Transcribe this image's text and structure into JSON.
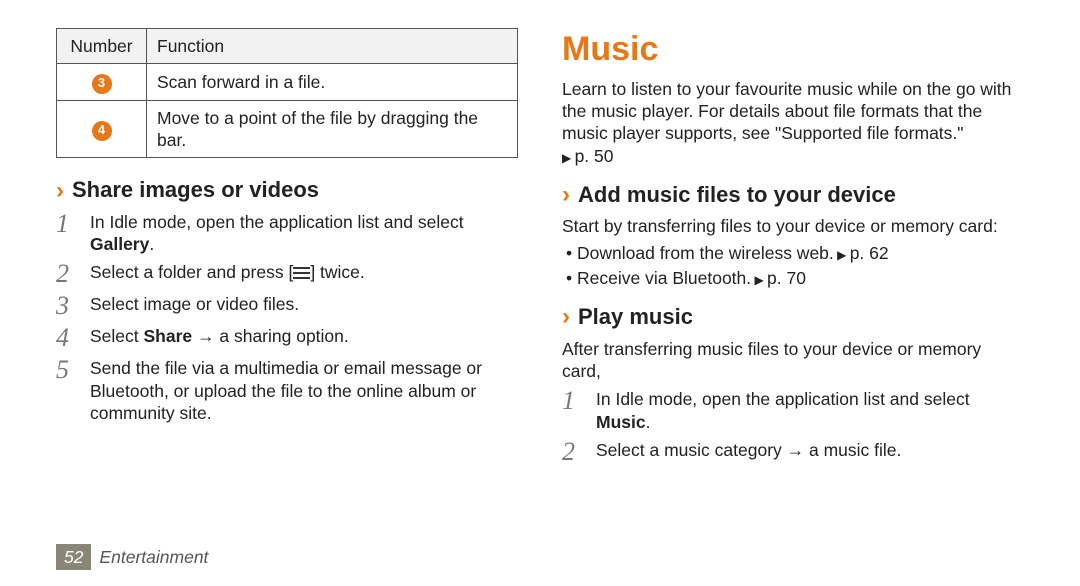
{
  "table": {
    "header_number": "Number",
    "header_function": "Function",
    "rows": [
      {
        "num": "3",
        "func": "Scan forward in a file."
      },
      {
        "num": "4",
        "func": "Move to a point of the file by dragging the bar."
      }
    ]
  },
  "left": {
    "subhead": "Share images or videos",
    "steps": [
      {
        "n": "1",
        "pre": "In Idle mode, open the application list and select ",
        "bold": "Gallery",
        "post": "."
      },
      {
        "n": "2",
        "pre": "Select a folder and press [",
        "icon": true,
        "post": "] twice."
      },
      {
        "n": "3",
        "pre": "Select image or video files.",
        "bold": "",
        "post": ""
      },
      {
        "n": "4",
        "pre": "Select ",
        "bold": "Share",
        "post": " → a sharing option."
      },
      {
        "n": "5",
        "pre": "Send the file via a multimedia or email message or Bluetooth, or upload the file to the online album or community site.",
        "bold": "",
        "post": ""
      }
    ]
  },
  "right": {
    "title": "Music",
    "intro": "Learn to listen to your favourite music while on the go with the music player. For details about file formats that the music player supports, see \"Supported file formats.\"",
    "intro_ref": "p. 50",
    "add_head": "Add music files to your device",
    "add_intro": "Start by transferring files to your device or memory card:",
    "add_bullets": [
      {
        "text": "Download from the wireless web.",
        "ref": "p. 62"
      },
      {
        "text": "Receive via Bluetooth.",
        "ref": "p. 70"
      }
    ],
    "play_head": "Play music",
    "play_intro": "After transferring music files to your device or memory card,",
    "play_steps": [
      {
        "n": "1",
        "pre": "In Idle mode, open the application list and select ",
        "bold": "Music",
        "post": "."
      },
      {
        "n": "2",
        "pre": "Select a music category → a music file.",
        "bold": "",
        "post": ""
      }
    ]
  },
  "footer": {
    "page": "52",
    "section": "Entertainment"
  }
}
